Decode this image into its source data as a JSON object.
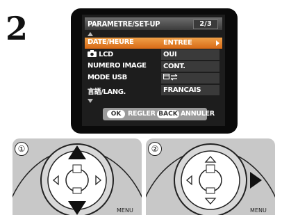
{
  "step_number": "2",
  "lcd": {
    "title": "PARAMETRE/SET-UP",
    "page": "2/3",
    "rows": [
      {
        "label": "DATE/HEURE",
        "value": "ENTREE",
        "selected": true
      },
      {
        "label": "LCD",
        "value": "OUI",
        "selected": false
      },
      {
        "label": "NUMERO IMAGE",
        "value": "CONT.",
        "selected": false
      },
      {
        "label": "MODE USB",
        "value": "",
        "selected": false
      },
      {
        "label": "言語/LANG.",
        "value": "FRANCAIS",
        "selected": false
      }
    ],
    "ok_button": "OK",
    "ok_action": "REGLER",
    "back_button": "BACK",
    "back_action": "ANNULER"
  },
  "panels": [
    {
      "number": "①",
      "menu_label": "MENU",
      "highlight": "up-down"
    },
    {
      "number": "②",
      "menu_label": "MENU",
      "highlight": "right"
    }
  ],
  "colors": {
    "selected_row": "#e07a20",
    "value_box": "#3a3a3a",
    "dial_highlight": "#111111"
  }
}
